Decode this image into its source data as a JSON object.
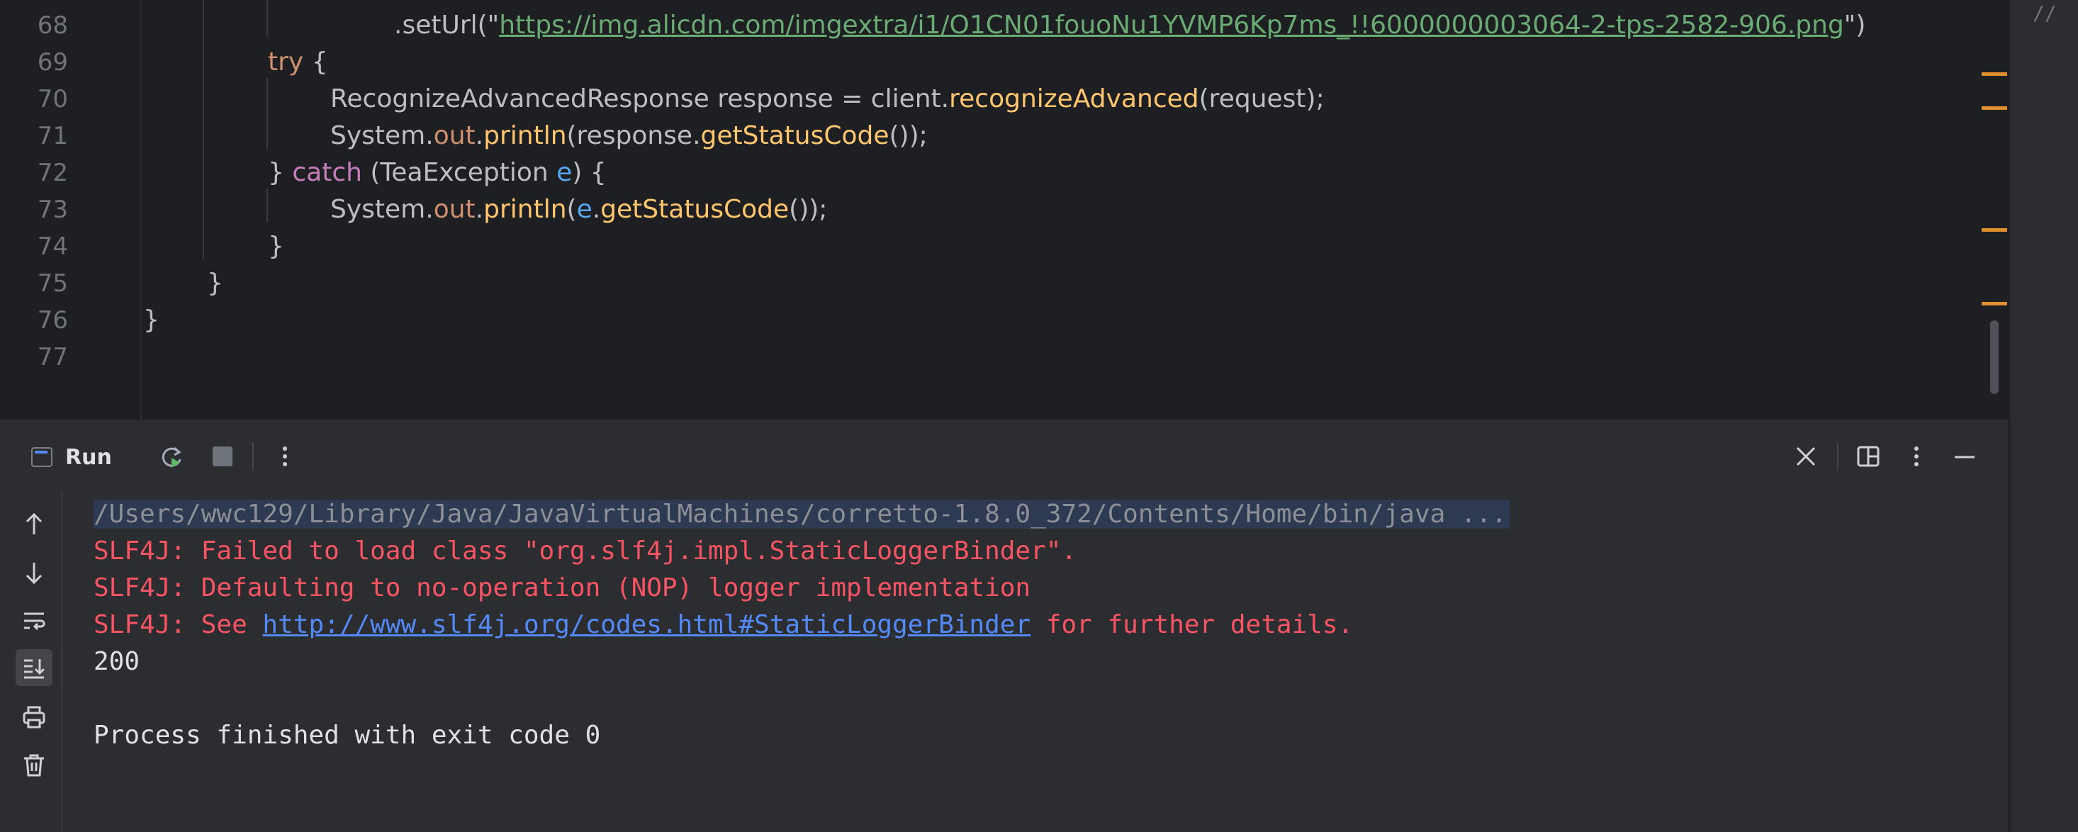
{
  "editor": {
    "lines": [
      {
        "num": "68"
      },
      {
        "num": "69"
      },
      {
        "num": "70"
      },
      {
        "num": "71"
      },
      {
        "num": "72"
      },
      {
        "num": "73"
      },
      {
        "num": "74"
      },
      {
        "num": "75"
      },
      {
        "num": "76"
      },
      {
        "num": "77"
      }
    ],
    "code": {
      "l68_method": ".setUrl",
      "l68_open": "(\"",
      "l68_url": "https://img.alicdn.com/imgextra/i1/O1CN01fouoNu1YVMP6Kp7ms_!!6000000003064-2-tps-2582-906.png",
      "l68_close": "\")",
      "l69_kw": "try",
      "l69_rest": " {",
      "l70_type": "RecognizeAdvancedResponse response = client.",
      "l70_method": "recognizeAdvanced",
      "l70_rest": "(request);",
      "l71_sys": "System.",
      "l71_out": "out",
      "l71_dot": ".",
      "l71_println": "println",
      "l71_arg": "(response.",
      "l71_getcode": "getStatusCode",
      "l71_end": "());",
      "l72_brace": "} ",
      "l72_catch": "catch",
      "l72_open": " (TeaException ",
      "l72_e": "e",
      "l72_close": ") {",
      "l73_sys": "System.",
      "l73_out": "out",
      "l73_dot": ".",
      "l73_println": "println",
      "l73_open": "(",
      "l73_e": "e",
      "l73_dot2": ".",
      "l73_getcode": "getStatusCode",
      "l73_end": "());",
      "l74": "}",
      "l75": "}",
      "l76": "}"
    },
    "overflow_marker": "//"
  },
  "run_panel": {
    "tab_label": "Run",
    "icons": {
      "rerun": "rerun-icon",
      "stop": "stop-icon",
      "more": "more-vertical-icon",
      "close": "close-icon",
      "layout": "layout-icon",
      "minimize": "minimize-icon"
    }
  },
  "console": {
    "command": "/Users/wwc129/Library/Java/JavaVirtualMachines/corretto-1.8.0_372/Contents/Home/bin/java ...",
    "err1": "SLF4J: Failed to load class \"org.slf4j.impl.StaticLoggerBinder\".",
    "err2": "SLF4J: Defaulting to no-operation (NOP) logger implementation",
    "err3_prefix": "SLF4J: See ",
    "err3_link": "http://www.slf4j.org/codes.html#StaticLoggerBinder",
    "err3_suffix": " for further details.",
    "output": "200",
    "finished": "Process finished with exit code 0"
  },
  "colors": {
    "editor_bg": "#1e1f22",
    "panel_bg": "#2b2d30",
    "keyword": "#cf8e6d",
    "method": "#ffc66d",
    "field": "#c77dbb",
    "string": "#6aab73",
    "error": "#f75464",
    "link": "#548af7",
    "marker": "#e0902f"
  }
}
